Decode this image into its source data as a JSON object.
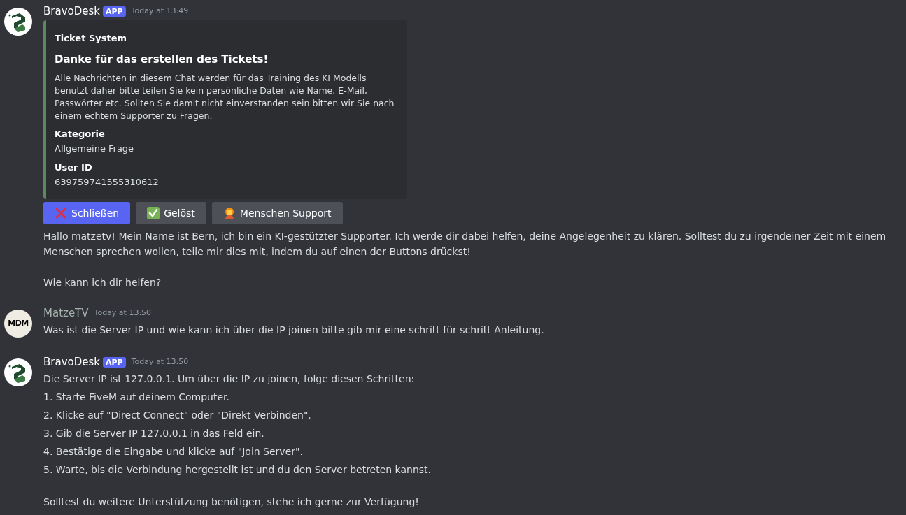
{
  "messages": [
    {
      "author": "BravoDesk",
      "avatar": {
        "kind": "logo"
      },
      "badge": "APP",
      "time": "Today at 13:49",
      "embed": {
        "author": "Ticket System",
        "title": "Danke für das erstellen des Tickets!",
        "description": "Alle Nachrichten in diesem Chat werden für das Training des KI Modells benutzt daher bitte teilen Sie kein persönliche Daten wie Name, E-Mail, Passwörter etc. Sollten Sie damit nicht einverstanden sein bitten wir Sie nach einem echtem Supporter zu Fragen.",
        "color": "#5b8a5c",
        "fields": [
          {
            "name": "Kategorie",
            "value": "Allgemeine Frage"
          },
          {
            "name": "User ID",
            "value": "639759741555310612"
          }
        ]
      },
      "buttons": [
        {
          "label": "Schließen",
          "kind": "primary"
        },
        {
          "label": "Gelöst",
          "kind": "secondary"
        },
        {
          "label": "Menschen Support",
          "kind": "secondary"
        }
      ],
      "content": [
        {
          "kind": "paragraph",
          "text": "Hallo matzetv! Mein Name ist Bern, ich bin ein KI-gestützter Supporter. Ich werde dir dabei helfen, deine Angelegenheit zu klären. Solltest du zu irgendeiner Zeit mit einem Menschen sprechen wollen, teile mir dies mit, indem du auf einen der Buttons drückst!"
        },
        {
          "kind": "paragraph",
          "text": "Wie kann ich dir helfen?"
        }
      ]
    },
    {
      "author": "MatzeTV",
      "avatar": {
        "kind": "initials",
        "text": "MDM"
      },
      "time": "Today at 13:50",
      "content": [
        {
          "kind": "line",
          "text": "Was ist die Server IP und wie kann ich über die IP joinen bitte gib mir eine schritt für schritt Anleitung."
        }
      ]
    },
    {
      "author": "BravoDesk",
      "avatar": {
        "kind": "logo"
      },
      "badge": "APP",
      "time": "Today at 13:50",
      "content": [
        {
          "kind": "line",
          "text": "Die Server IP ist 127.0.0.1. Um über die IP zu joinen, folge diesen Schritten:"
        },
        {
          "kind": "line",
          "text": "1. Starte FiveM auf deinem Computer."
        },
        {
          "kind": "line",
          "text": "2. Klicke auf \"Direct Connect\" oder \"Direkt Verbinden\"."
        },
        {
          "kind": "line",
          "text": "3. Gib die Server IP 127.0.0.1 in das Feld ein."
        },
        {
          "kind": "line",
          "text": "4. Bestätige die Eingabe und klicke auf \"Join Server\"."
        },
        {
          "kind": "line",
          "text": "5. Warte, bis die Verbindung hergestellt ist und du den Server betreten kannst."
        },
        {
          "kind": "paragraph",
          "text": "Solltest du weitere Unterstützung benötigen, stehe ich gerne zur Verfügung!"
        }
      ]
    }
  ]
}
